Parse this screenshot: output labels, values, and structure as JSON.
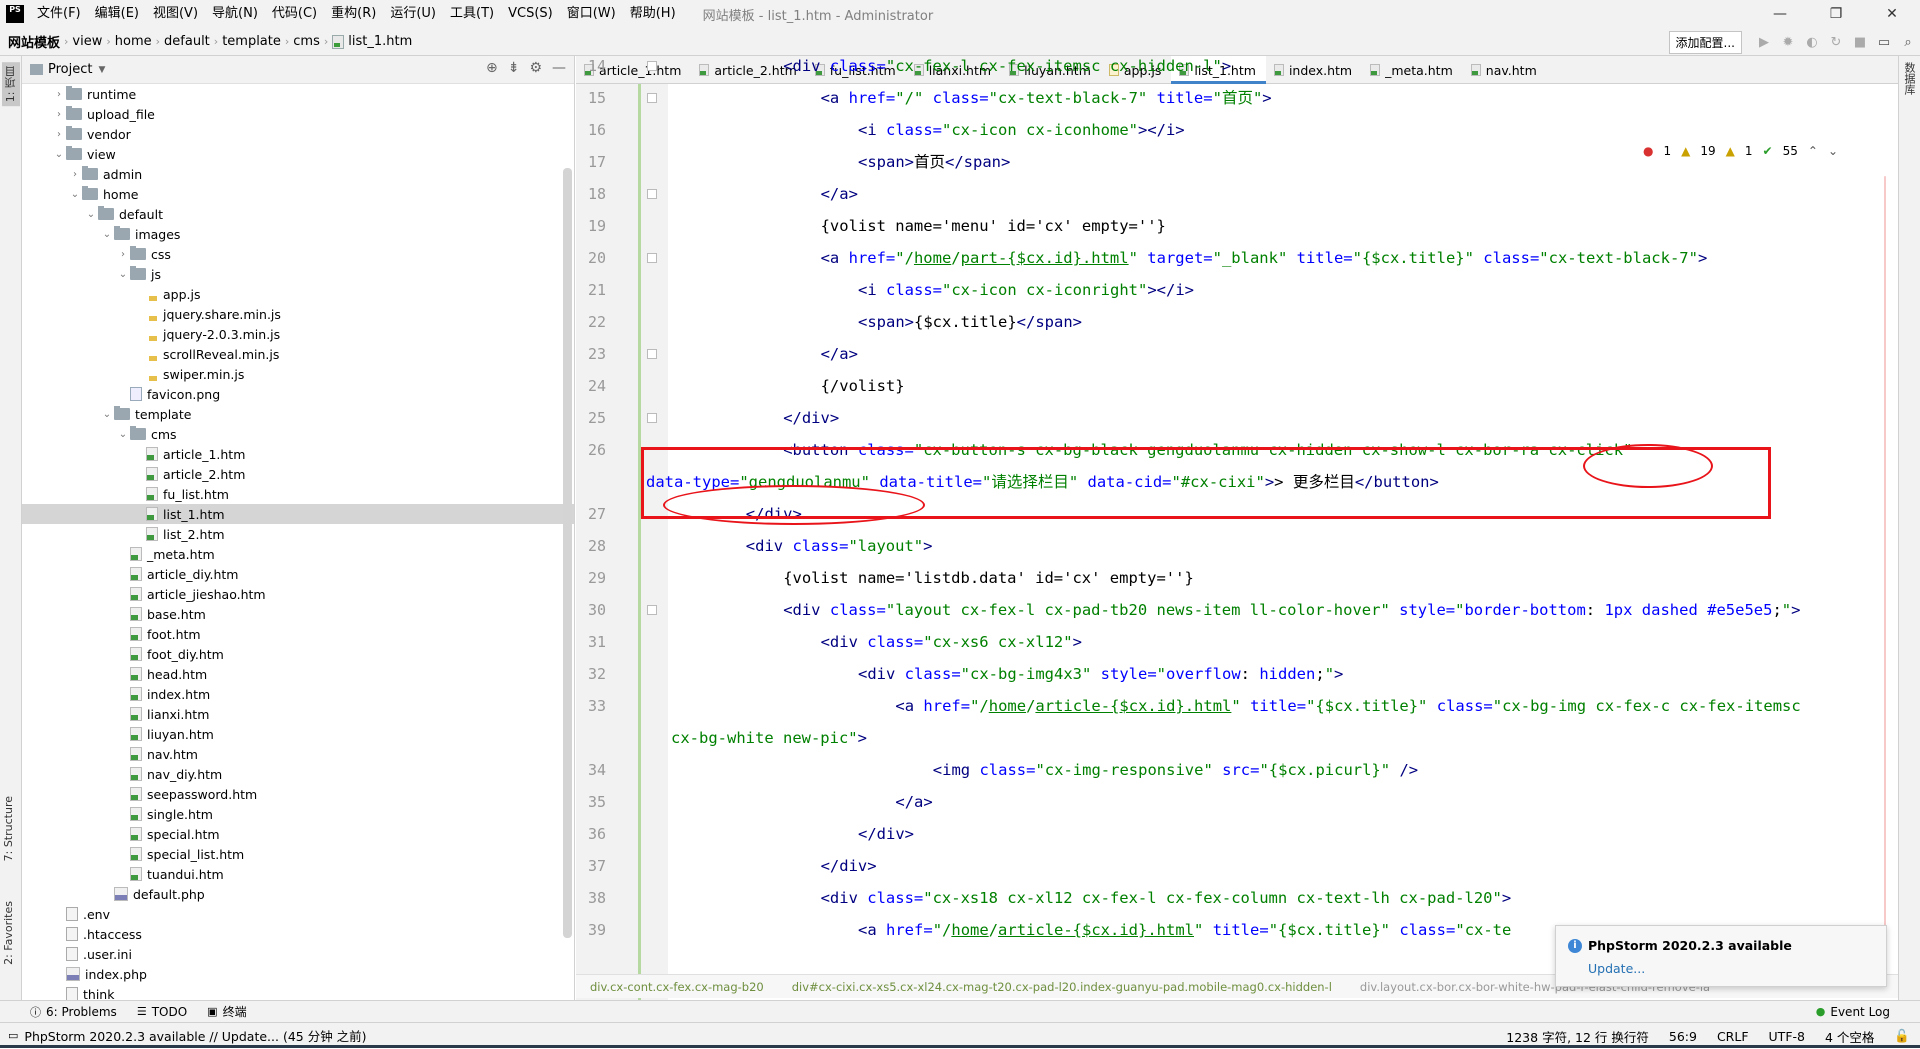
{
  "titlebar": {
    "logo": "PS",
    "menus": [
      "文件(F)",
      "编辑(E)",
      "视图(V)",
      "导航(N)",
      "代码(C)",
      "重构(R)",
      "运行(U)",
      "工具(T)",
      "VCS(S)",
      "窗口(W)",
      "帮助(H)"
    ],
    "window_title": "网站模板 - list_1.htm - Administrator",
    "controls": [
      "—",
      "❐",
      "✕"
    ]
  },
  "breadcrumb": [
    "网站模板",
    "view",
    "home",
    "default",
    "template",
    "cms",
    "list_1.htm"
  ],
  "toolbar": {
    "add_config": "添加配置..."
  },
  "side_tabs": {
    "project": "1: 项目",
    "structure": "7: Structure",
    "favorites": "2: Favorites",
    "database": "数据库"
  },
  "project": {
    "title": "Project",
    "tree": [
      {
        "label": "runtime",
        "type": "folder",
        "depth": 1,
        "arrow": "right"
      },
      {
        "label": "upload_file",
        "type": "folder",
        "depth": 1,
        "arrow": "right"
      },
      {
        "label": "vendor",
        "type": "folder",
        "depth": 1,
        "arrow": "right"
      },
      {
        "label": "view",
        "type": "folder",
        "depth": 1,
        "arrow": "down"
      },
      {
        "label": "admin",
        "type": "folder",
        "depth": 2,
        "arrow": "right"
      },
      {
        "label": "home",
        "type": "folder",
        "depth": 2,
        "arrow": "down"
      },
      {
        "label": "default",
        "type": "folder",
        "depth": 3,
        "arrow": "down"
      },
      {
        "label": "images",
        "type": "folder",
        "depth": 4,
        "arrow": "down"
      },
      {
        "label": "css",
        "type": "folder",
        "depth": 5,
        "arrow": "right"
      },
      {
        "label": "js",
        "type": "folder",
        "depth": 5,
        "arrow": "down"
      },
      {
        "label": "app.js",
        "type": "js",
        "depth": 6,
        "arrow": ""
      },
      {
        "label": "jquery.share.min.js",
        "type": "js",
        "depth": 6,
        "arrow": ""
      },
      {
        "label": "jquery-2.0.3.min.js",
        "type": "js",
        "depth": 6,
        "arrow": ""
      },
      {
        "label": "scrollReveal.min.js",
        "type": "js",
        "depth": 6,
        "arrow": ""
      },
      {
        "label": "swiper.min.js",
        "type": "js",
        "depth": 6,
        "arrow": ""
      },
      {
        "label": "favicon.png",
        "type": "png",
        "depth": 5,
        "arrow": ""
      },
      {
        "label": "template",
        "type": "folder",
        "depth": 4,
        "arrow": "down"
      },
      {
        "label": "cms",
        "type": "folder",
        "depth": 5,
        "arrow": "down"
      },
      {
        "label": "article_1.htm",
        "type": "html",
        "depth": 6,
        "arrow": ""
      },
      {
        "label": "article_2.htm",
        "type": "html",
        "depth": 6,
        "arrow": ""
      },
      {
        "label": "fu_list.htm",
        "type": "html",
        "depth": 6,
        "arrow": ""
      },
      {
        "label": "list_1.htm",
        "type": "html",
        "depth": 6,
        "arrow": "",
        "selected": true
      },
      {
        "label": "list_2.htm",
        "type": "html",
        "depth": 6,
        "arrow": ""
      },
      {
        "label": "_meta.htm",
        "type": "html",
        "depth": 5,
        "arrow": ""
      },
      {
        "label": "article_diy.htm",
        "type": "html",
        "depth": 5,
        "arrow": ""
      },
      {
        "label": "article_jieshao.htm",
        "type": "html",
        "depth": 5,
        "arrow": ""
      },
      {
        "label": "base.htm",
        "type": "html",
        "depth": 5,
        "arrow": ""
      },
      {
        "label": "foot.htm",
        "type": "html",
        "depth": 5,
        "arrow": ""
      },
      {
        "label": "foot_diy.htm",
        "type": "html",
        "depth": 5,
        "arrow": ""
      },
      {
        "label": "head.htm",
        "type": "html",
        "depth": 5,
        "arrow": ""
      },
      {
        "label": "index.htm",
        "type": "html",
        "depth": 5,
        "arrow": ""
      },
      {
        "label": "lianxi.htm",
        "type": "html",
        "depth": 5,
        "arrow": ""
      },
      {
        "label": "liuyan.htm",
        "type": "html",
        "depth": 5,
        "arrow": ""
      },
      {
        "label": "nav.htm",
        "type": "html",
        "depth": 5,
        "arrow": ""
      },
      {
        "label": "nav_diy.htm",
        "type": "html",
        "depth": 5,
        "arrow": ""
      },
      {
        "label": "seepassword.htm",
        "type": "html",
        "depth": 5,
        "arrow": ""
      },
      {
        "label": "single.htm",
        "type": "html",
        "depth": 5,
        "arrow": ""
      },
      {
        "label": "special.htm",
        "type": "html",
        "depth": 5,
        "arrow": ""
      },
      {
        "label": "special_list.htm",
        "type": "html",
        "depth": 5,
        "arrow": ""
      },
      {
        "label": "tuandui.htm",
        "type": "html",
        "depth": 5,
        "arrow": ""
      },
      {
        "label": "default.php",
        "type": "php",
        "depth": 4,
        "arrow": ""
      },
      {
        "label": ".env",
        "type": "txt",
        "depth": 1,
        "arrow": ""
      },
      {
        "label": ".htaccess",
        "type": "txt",
        "depth": 1,
        "arrow": ""
      },
      {
        "label": ".user.ini",
        "type": "txt",
        "depth": 1,
        "arrow": ""
      },
      {
        "label": "index.php",
        "type": "php",
        "depth": 1,
        "arrow": ""
      },
      {
        "label": "think",
        "type": "txt",
        "depth": 1,
        "arrow": ""
      }
    ]
  },
  "tabs": [
    {
      "label": "article_1.htm",
      "icon": "html"
    },
    {
      "label": "article_2.htm",
      "icon": "html"
    },
    {
      "label": "fu_list.htm",
      "icon": "html"
    },
    {
      "label": "lianxi.htm",
      "icon": "html"
    },
    {
      "label": "liuyan.htm",
      "icon": "html"
    },
    {
      "label": "app.js",
      "icon": "js"
    },
    {
      "label": "list_1.htm",
      "icon": "html",
      "active": true
    },
    {
      "label": "index.htm",
      "icon": "html"
    },
    {
      "label": "_meta.htm",
      "icon": "html"
    },
    {
      "label": "nav.htm",
      "icon": "html"
    }
  ],
  "inspections": {
    "errors": "1",
    "warnings": "19",
    "weak": "1",
    "ok": "55"
  },
  "code_lines": [
    {
      "n": "14",
      "indent": 12,
      "html": "<span class=\"tag\">&lt;div</span> <span class=\"attr\">class=</span><span class=\"str\">\"cx-fex-l cx-fex-itemsc cx-hidden-l\"</span><span class=\"tag\">&gt;</span>"
    },
    {
      "n": "15",
      "indent": 16,
      "html": "<span class=\"tag\">&lt;a</span> <span class=\"attr\">href=</span><span class=\"str\">\"/\"</span> <span class=\"attr\">class=</span><span class=\"str\">\"cx-text-black-7\"</span> <span class=\"attr\">title=</span><span class=\"str\">\"首页\"</span><span class=\"tag\">&gt;</span>"
    },
    {
      "n": "16",
      "indent": 20,
      "html": "<span class=\"tag\">&lt;i</span> <span class=\"attr\">class=</span><span class=\"str\">\"cx-icon cx-iconhome\"</span><span class=\"tag\">&gt;&lt;/i&gt;</span>"
    },
    {
      "n": "17",
      "indent": 20,
      "html": "<span class=\"tag\">&lt;span&gt;</span>首页<span class=\"tag\">&lt;/span&gt;</span>"
    },
    {
      "n": "18",
      "indent": 16,
      "html": "<span class=\"tag\">&lt;/a&gt;</span>"
    },
    {
      "n": "19",
      "indent": 16,
      "html": "{volist name='menu' id='cx' empty=''}"
    },
    {
      "n": "20",
      "indent": 16,
      "html": "<span class=\"tag\">&lt;a</span> <span class=\"attr\">href=</span><span class=\"str\">\"/<u>home</u>/<u>part-{$cx.id}.html</u>\"</span> <span class=\"attr\">target=</span><span class=\"str\">\"_blank\"</span> <span class=\"attr\">title=</span><span class=\"str\">\"{$cx.title}\"</span> <span class=\"attr\">class=</span><span class=\"str\">\"cx-text-black-7\"</span><span class=\"tag\">&gt;</span>"
    },
    {
      "n": "21",
      "indent": 20,
      "html": "<span class=\"tag\">&lt;i</span> <span class=\"attr\">class=</span><span class=\"str\">\"cx-icon cx-iconright\"</span><span class=\"tag\">&gt;&lt;/i&gt;</span>"
    },
    {
      "n": "22",
      "indent": 20,
      "html": "<span class=\"tag\">&lt;span&gt;</span>{$cx.title}<span class=\"tag\">&lt;/span&gt;</span>"
    },
    {
      "n": "23",
      "indent": 16,
      "html": "<span class=\"tag\">&lt;/a&gt;</span>"
    },
    {
      "n": "24",
      "indent": 16,
      "html": "{/volist}"
    },
    {
      "n": "25",
      "indent": 12,
      "html": "<span class=\"tag\">&lt;/div&gt;</span>"
    },
    {
      "n": "26",
      "indent": 12,
      "html": "<span class=\"tag\">&lt;button</span> <span class=\"attr\">class=</span><span class=\"str\">\"cx-button-s cx-bg-black gengduolanmu cx-hidden cx-show-l cx-bor-ra cx-click\"</span>"
    },
    {
      "n": "",
      "indent": -1,
      "html": "<span class=\"attr\">data-type=</span><span class=\"str\">\"gengduolanmu\"</span> <span class=\"attr\">data-title=</span><span class=\"str\">\"请选择栏目\"</span> <span class=\"attr\">data-cid=</span><span class=\"str\">\"#cx-cixi\"</span><span class=\"tag\">&gt;</span>&gt; 更多栏目<span class=\"tag\">&lt;/button&gt;</span>"
    },
    {
      "n": "27",
      "indent": 8,
      "html": "<span class=\"tag\">&lt;/div&gt;</span>"
    },
    {
      "n": "28",
      "indent": 8,
      "html": "<span class=\"tag\">&lt;div</span> <span class=\"attr\">class=</span><span class=\"str\">\"layout\"</span><span class=\"tag\">&gt;</span>"
    },
    {
      "n": "29",
      "indent": 12,
      "html": "{volist name='listdb.data' id='cx' empty=''}"
    },
    {
      "n": "30",
      "indent": 12,
      "html": "<span class=\"tag\">&lt;div</span> <span class=\"attr\">class=</span><span class=\"str\">\"layout cx-fex-l cx-pad-tb20 news-item ll-color-hover\"</span> <span class=\"attr\">style=</span><span class=\"str\">\"</span><span class=\"attr\">border-bottom</span>: <span class=\"attr\">1px dashed #e5e5e5</span>;<span class=\"str\">\"</span><span class=\"tag\">&gt;</span>"
    },
    {
      "n": "31",
      "indent": 16,
      "html": "<span class=\"tag\">&lt;div</span> <span class=\"attr\">class=</span><span class=\"str\">\"cx-xs6 cx-xl12\"</span><span class=\"tag\">&gt;</span>"
    },
    {
      "n": "32",
      "indent": 20,
      "html": "<span class=\"tag\">&lt;div</span> <span class=\"attr\">class=</span><span class=\"str\">\"cx-bg-img4x3\"</span> <span class=\"attr\">style=</span><span class=\"str\">\"</span><span class=\"attr\">overflow</span>: <span class=\"attr\">hidden</span>;<span class=\"str\">\"</span><span class=\"tag\">&gt;</span>"
    },
    {
      "n": "33",
      "indent": 24,
      "html": "<span class=\"tag\">&lt;a</span> <span class=\"attr\">href=</span><span class=\"str\">\"/<u>home</u>/<u>article-{$cx.id}.html</u>\"</span> <span class=\"attr\">title=</span><span class=\"str\">\"{$cx.title}\"</span> <span class=\"attr\">class=</span><span class=\"str\">\"cx-bg-img cx-fex-c cx-fex-itemsc</span>"
    },
    {
      "n": "",
      "indent": 0,
      "html": "<span class=\"str\">cx-bg-white new-pic\"</span><span class=\"tag\">&gt;</span>"
    },
    {
      "n": "34",
      "indent": 28,
      "html": "<span class=\"tag\">&lt;img</span> <span class=\"attr\">class=</span><span class=\"str\">\"cx-img-responsive\"</span> <span class=\"attr\">src=</span><span class=\"str\">\"{$cx.picurl}\"</span> <span class=\"tag\">/&gt;</span>"
    },
    {
      "n": "35",
      "indent": 24,
      "html": "<span class=\"tag\">&lt;/a&gt;</span>"
    },
    {
      "n": "36",
      "indent": 20,
      "html": "<span class=\"tag\">&lt;/div&gt;</span>"
    },
    {
      "n": "37",
      "indent": 16,
      "html": "<span class=\"tag\">&lt;/div&gt;</span>"
    },
    {
      "n": "38",
      "indent": 16,
      "html": "<span class=\"tag\">&lt;div</span> <span class=\"attr\">class=</span><span class=\"str\">\"cx-xs18 cx-xl12 cx-fex-l cx-fex-column cx-text-lh cx-pad-l20\"</span><span class=\"tag\">&gt;</span>"
    },
    {
      "n": "39",
      "indent": 20,
      "html": "<span class=\"tag\">&lt;a</span> <span class=\"attr\">href=</span><span class=\"str\">\"/<u>home</u>/<u>article-{$cx.id}.html</u>\"</span> <span class=\"attr\">title=</span><span class=\"str\">\"{$cx.title}\"</span> <span class=\"attr\">class=</span><span class=\"str\">\"cx-te</span>"
    }
  ],
  "breadcrumb_bottom": [
    "div.cx-cont.cx-fex.cx-mag-b20",
    "div#cx-cixi.cx-xs5.cx-xl24.cx-mag-t20.cx-pad-l20.index-guanyu-pad.mobile-mag0.cx-hidden-l",
    "div.layout.cx-bor.cx-bor-white-hw-pad-r-elast-child-remove-la"
  ],
  "notification": {
    "title": "PhpStorm 2020.2.3 available",
    "link": "Update..."
  },
  "bottom_tools": [
    {
      "label": "6: Problems",
      "icon": "problems-icon"
    },
    {
      "label": "TODO",
      "icon": "todo-icon"
    },
    {
      "label": "终端",
      "icon": "terminal-icon"
    }
  ],
  "event_log": "Event Log",
  "status": {
    "message": "PhpStorm 2020.2.3 available // Update... (45 分钟 之前)",
    "chars": "1238 字符, 12 行 换行符",
    "pos": "56:9",
    "line_sep": "CRLF",
    "encoding": "UTF-8",
    "indent": "4 个空格"
  }
}
